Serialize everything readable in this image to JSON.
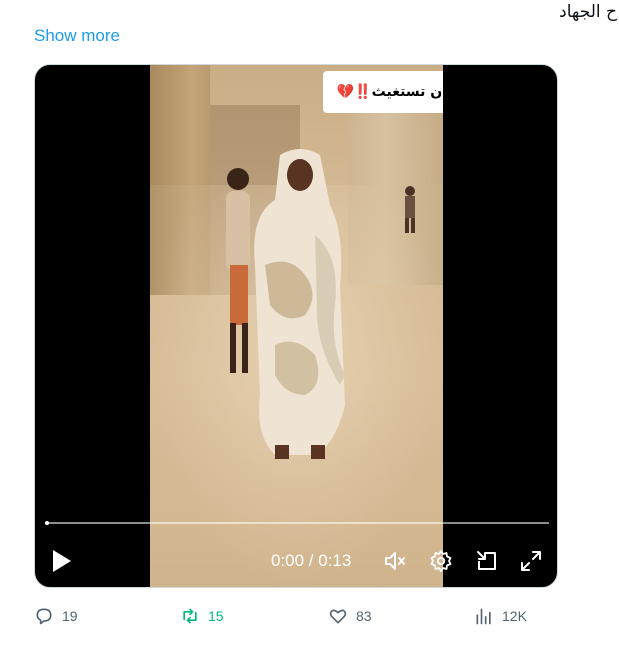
{
  "tweet": {
    "text": "ح الجهاد",
    "show_more": "Show more"
  },
  "video": {
    "caption": "السودان تستغيث",
    "caption_emoji": "‼️💔",
    "time": "0:00 / 0:13",
    "progress_fraction": 0.0,
    "controls": {
      "play_icon": "play-icon",
      "mute_icon": "volume-muted-icon",
      "settings_icon": "gear-icon",
      "pip_icon": "picture-in-picture-icon",
      "fullscreen_icon": "fullscreen-icon"
    }
  },
  "actions": {
    "replies": "19",
    "retweets": "15",
    "likes": "83",
    "views": "12K"
  },
  "colors": {
    "link": "#1d9bf0",
    "retweet": "#00ba7c",
    "muted_text": "#536471"
  }
}
